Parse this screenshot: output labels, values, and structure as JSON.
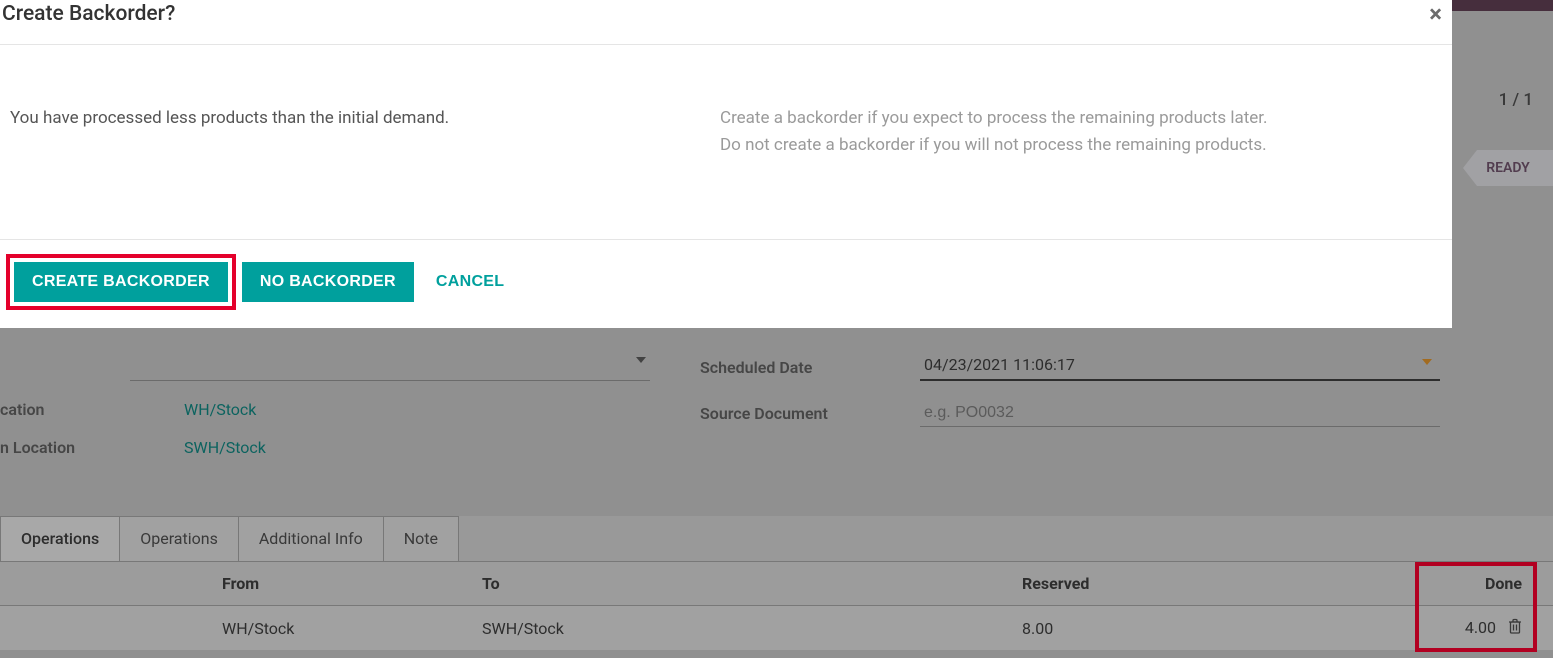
{
  "modal": {
    "title": "Create Backorder?",
    "body_left": "You have processed less products than the initial demand.",
    "body_right_l1": "Create a backorder if you expect to process the remaining products later.",
    "body_right_l2": "Do not create a backorder if you will not process the remaining products.",
    "btn_create": "CREATE BACKORDER",
    "btn_no": "NO BACKORDER",
    "btn_cancel": "CANCEL"
  },
  "pager": "1 / 1",
  "status": "READY",
  "form": {
    "location_label": "cation",
    "location_value": "WH/Stock",
    "dest_label": "n Location",
    "dest_value": "SWH/Stock",
    "sched_label": "Scheduled Date",
    "sched_value": "04/23/2021 11:06:17",
    "source_label": "Source Document",
    "source_placeholder": "e.g. PO0032"
  },
  "tabs": {
    "t0": "Operations",
    "t1": "Operations",
    "t2": "Additional Info",
    "t3": "Note"
  },
  "grid": {
    "h_from": "From",
    "h_to": "To",
    "h_reserved": "Reserved",
    "h_done": "Done",
    "row0": {
      "from": "WH/Stock",
      "to": "SWH/Stock",
      "reserved": "8.00",
      "done": "4.00"
    }
  }
}
